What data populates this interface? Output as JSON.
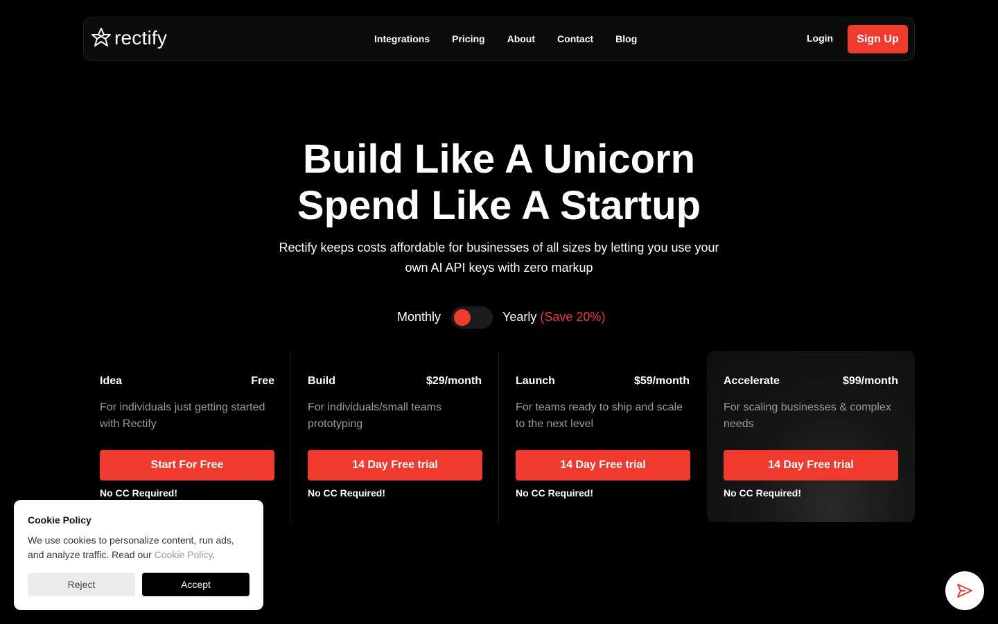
{
  "brand": {
    "name": "rectify",
    "icon": "rectify-star-logo-icon"
  },
  "nav": {
    "links": [
      "Integrations",
      "Pricing",
      "About",
      "Contact",
      "Blog"
    ],
    "login": "Login",
    "signup": "Sign Up"
  },
  "hero": {
    "title_line1": "Build Like A Unicorn",
    "title_line2": "Spend Like A Startup",
    "subtitle": "Rectify keeps costs affordable for businesses of all sizes by letting you use your own AI API keys with zero markup"
  },
  "billing_toggle": {
    "monthly_label": "Monthly",
    "yearly_label": "Yearly",
    "save_label": "(Save 20%)",
    "selected": "Monthly"
  },
  "plans": [
    {
      "name": "Idea",
      "price": "Free",
      "description": "For individuals just getting started with Rectify",
      "cta": "Start For Free",
      "note": "No CC Required!"
    },
    {
      "name": "Build",
      "price": "$29/month",
      "description": "For individuals/small teams prototyping",
      "cta": "14 Day Free trial",
      "note": "No CC Required!"
    },
    {
      "name": "Launch",
      "price": "$59/month",
      "description": "For teams ready to ship and scale to the next level",
      "cta": "14 Day Free trial",
      "note": "No CC Required!"
    },
    {
      "name": "Accelerate",
      "price": "$99/month",
      "description": "For scaling businesses & complex needs",
      "cta": "14 Day Free trial",
      "note": "No CC Required!"
    }
  ],
  "cookie": {
    "title": "Cookie Policy",
    "text_before": "We use cookies to personalize content, run ads, and analyze traffic. Read our ",
    "link": "Cookie Policy",
    "text_after": ".",
    "reject": "Reject",
    "accept": "Accept"
  },
  "chat_fab": {
    "icon": "send-icon"
  },
  "colors": {
    "accent": "#f13a2e",
    "background": "#000000",
    "muted_text": "#9a9a9a"
  }
}
